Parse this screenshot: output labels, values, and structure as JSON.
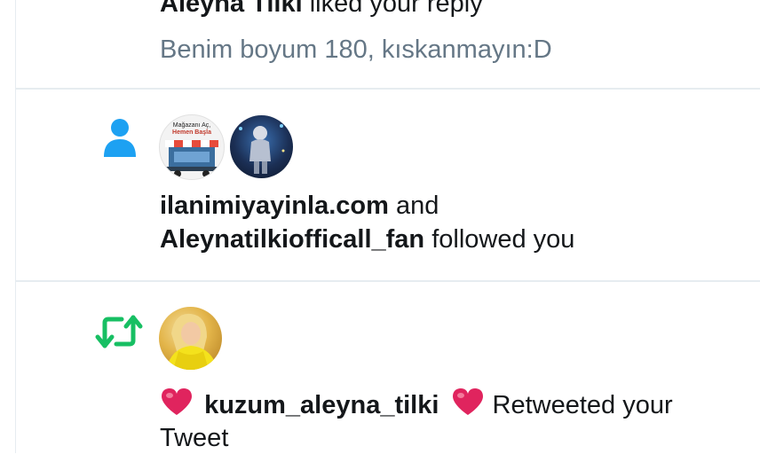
{
  "notifications": [
    {
      "type": "like",
      "actor": "Aleyna Tilki",
      "action": "liked your reply",
      "snippet": "Benim boyum 180, kıskanmayın:D"
    },
    {
      "type": "follow",
      "actor1": "ilanimiyayinla.com",
      "conjunction": "and",
      "actor2": "Aleynatilkiofficall_fan",
      "action": "followed you",
      "avatar1_text_line1": "Mağazanı Aç,",
      "avatar1_text_line2": "Hemen Başla"
    },
    {
      "type": "retweet",
      "actor": "kuzum_aleyna_tilki",
      "action": "Retweeted your",
      "action_line2": "Tweet"
    }
  ],
  "colors": {
    "follow_icon": "#1da1f2",
    "retweet_icon": "#17bf63",
    "heart": "#e0245e",
    "divider": "#e6ecf0",
    "muted_text": "#657786"
  },
  "icons": [
    "person-icon",
    "retweet-icon",
    "heart-emoji-icon"
  ]
}
